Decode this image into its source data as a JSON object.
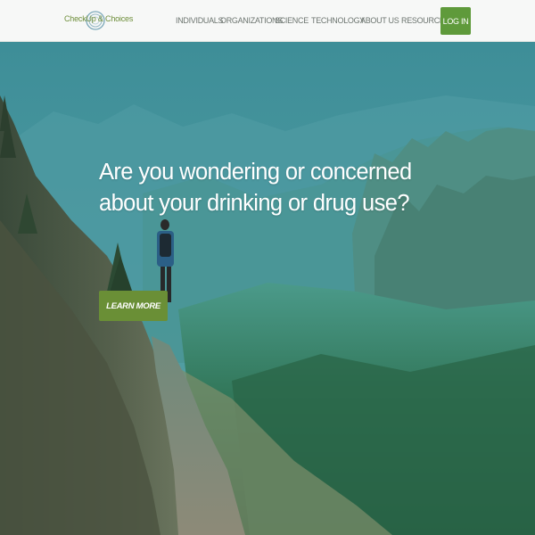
{
  "brand": {
    "logo_text": "CheckUp & Choices",
    "accent_color": "#5f9a3b"
  },
  "nav": {
    "items": [
      {
        "label": "INDIVIDUALS"
      },
      {
        "label": "ORGANIZATIONS"
      },
      {
        "label": "SCIENCE"
      },
      {
        "label": "TECHNOLOGY"
      },
      {
        "label": "ABOUT US"
      },
      {
        "label": "RESOURCES"
      }
    ],
    "login_label": "LOG IN"
  },
  "hero": {
    "headline_line1": "Are you wondering or concerned",
    "headline_line2": "about your drinking or drug use?",
    "cta_label": "LEARN MORE",
    "cta_color": "#6a8f36"
  }
}
